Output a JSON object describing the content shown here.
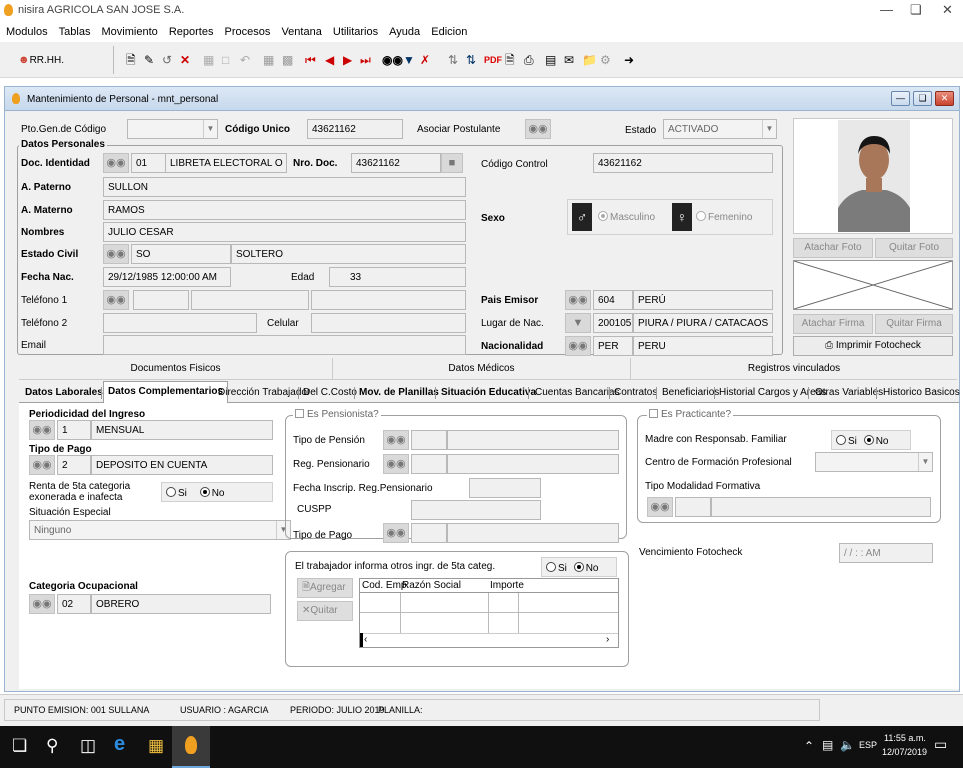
{
  "app": {
    "title": "nisira AGRICOLA SAN JOSE S.A."
  },
  "menu": [
    "Modulos",
    "Tablas",
    "Movimiento",
    "Reportes",
    "Procesos",
    "Ventana",
    "Utilitarios",
    "Ayuda",
    "Edicion"
  ],
  "toolbar": {
    "module_label": "RR.HH.",
    "pdf_label": "PDF"
  },
  "window": {
    "title": "Mantenimiento de Personal - mnt_personal"
  },
  "header_row": {
    "pto_gen_label": "Pto.Gen.de Código",
    "codigo_unico_label": "Código Unico",
    "codigo_unico_value": "43621162",
    "asociar_label": "Asociar Postulante",
    "estado_label": "Estado",
    "estado_value": "ACTIVADO"
  },
  "datos_personales": {
    "title": "Datos Personales",
    "doc_identidad_label": "Doc. Identidad",
    "doc_code": "01",
    "doc_desc": "LIBRETA ELECTORAL O DNI",
    "nro_doc_label": "Nro. Doc.",
    "nro_doc_value": "43621162",
    "codigo_control_label": "Código Control",
    "codigo_control_value": "43621162",
    "a_paterno_label": "A. Paterno",
    "a_paterno_value": "SULLON",
    "a_materno_label": "A. Materno",
    "a_materno_value": "RAMOS",
    "sexo_label": "Sexo",
    "masculino_label": "Masculino",
    "femenino_label": "Femenino",
    "nombres_label": "Nombres",
    "nombres_value": "JULIO CESAR",
    "estado_civil_label": "Estado Civil",
    "estado_civil_code": "SO",
    "estado_civil_desc": "SOLTERO",
    "fecha_nac_label": "Fecha Nac.",
    "fecha_nac_value": "29/12/1985 12:00:00 AM",
    "edad_label": "Edad",
    "edad_value": "33",
    "telefono1_label": "Teléfono 1",
    "telefono2_label": "Teléfono 2",
    "celular_label": "Celular",
    "email_label": "Email",
    "pais_emisor_label": "Pais Emisor",
    "pais_emisor_code": "604",
    "pais_emisor_desc": "PERÚ",
    "lugar_nac_label": "Lugar de Nac.",
    "lugar_nac_code": "200105",
    "lugar_nac_desc": "PIURA / PIURA / CATACAOS",
    "nacionalidad_label": "Nacionalidad",
    "nacionalidad_code": "PER",
    "nacionalidad_desc": "PERU"
  },
  "photo_buttons": {
    "atachar_foto": "Atachar Foto",
    "quitar_foto": "Quitar Foto",
    "atachar_firma": "Atachar Firma",
    "quitar_firma": "Quitar Firma",
    "imprimir": "Imprimir Fotocheck"
  },
  "tabs_top": [
    "Documentos Fisicos",
    "Datos Médicos",
    "Registros vinculados"
  ],
  "tabs_bottom": [
    "Datos Laborales",
    "Datos Complementarios",
    "Dirección Trabajador",
    "Del C.Costo",
    "Mov. de Planillas",
    "Situación Educativa",
    "Cuentas Bancarias",
    "Contratos",
    "Beneficiarios",
    "Historial Cargos y Areas",
    "Otras Variables",
    "Historico Basicos"
  ],
  "complementarios": {
    "periodicidad_label": "Periodicidad del Ingreso",
    "periodicidad_code": "1",
    "periodicidad_desc": "MENSUAL",
    "tipo_pago_label": "Tipo de Pago",
    "tipo_pago_code": "2",
    "tipo_pago_desc": "DEPOSITO EN CUENTA",
    "renta_label": "Renta de 5ta categoria exonerada e inafecta",
    "si_label": "Si",
    "no_label": "No",
    "situacion_label": "Situación Especial",
    "situacion_value": "Ninguno",
    "categoria_label": "Categoria Ocupacional",
    "categoria_code": "02",
    "categoria_desc": "OBRERO",
    "pensionista_label": "Es Pensionista?",
    "tipo_pension_label": "Tipo de Pensión",
    "reg_pensionario_label": "Reg. Pensionario",
    "fecha_inscrip_label": "Fecha Inscrip. Reg.Pensionario",
    "cuspp_label": "CUSPP",
    "tipo_pago2_label": "Tipo de Pago",
    "otros_ingr_label": "El trabajador informa otros ingr. de 5ta categ.",
    "agregar_label": "Agregar",
    "quitar_label": "Quitar",
    "grid_cols": [
      "Cod. Emp.",
      "Razón Social",
      "Importe"
    ],
    "practicante_label": "Es Practicante?",
    "madre_label": "Madre con Responsab. Familiar",
    "centro_label": "Centro de Formación Profesional",
    "modalidad_label": "Tipo Modalidad Formativa",
    "vencimiento_label": "Vencimiento Fotocheck",
    "vencimiento_value": "/ /   : : AM"
  },
  "status": {
    "punto": "PUNTO EMISION: 001 SULLANA",
    "usuario": "USUARIO : AGARCIA",
    "periodo": "PERIODO: JULIO 2019",
    "planilla": "PLANILLA:"
  },
  "taskbar": {
    "time": "11:55 a.m.",
    "date": "12/07/2019",
    "lang": "ESP"
  }
}
